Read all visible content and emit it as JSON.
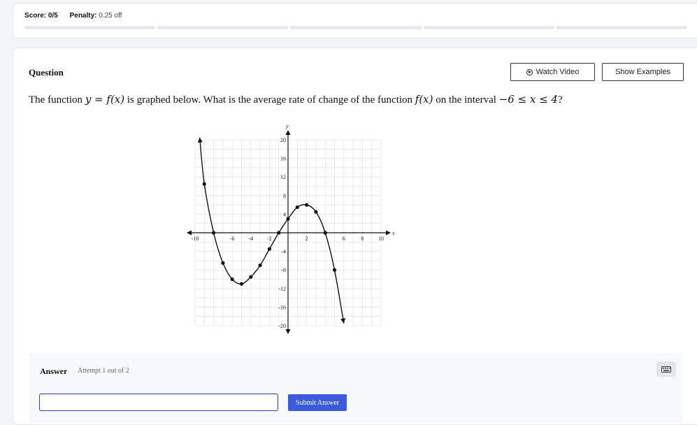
{
  "header": {
    "score_label": "Score:",
    "score_value": "0/5",
    "penalty_label": "Penalty:",
    "penalty_value": "0.25 off",
    "progress_segments": 5
  },
  "question": {
    "label": "Question",
    "watch_video": "Watch Video",
    "show_examples": "Show Examples",
    "text_1": "The function ",
    "math_1": "y = f(x)",
    "text_2": " is graphed below. What is the average rate of change of the function ",
    "math_2": "f(x)",
    "text_3": " on the interval ",
    "math_3": "−6 ≤ x ≤ 4",
    "text_4": "?"
  },
  "graph": {
    "x_axis_label": "x",
    "y_axis_label": "y",
    "x_tick_labels": [
      {
        "value": -10,
        "label": "-10"
      },
      {
        "value": -6,
        "label": "-6"
      },
      {
        "value": -4,
        "label": "-4"
      },
      {
        "value": -2,
        "label": "-2"
      },
      {
        "value": 2,
        "label": "2"
      },
      {
        "value": 6,
        "label": "6"
      },
      {
        "value": 8,
        "label": "8"
      },
      {
        "value": 10,
        "label": "10"
      }
    ],
    "y_tick_labels": [
      {
        "value": 20,
        "label": "20"
      },
      {
        "value": 16,
        "label": "16"
      },
      {
        "value": 12,
        "label": "12"
      },
      {
        "value": 8,
        "label": "8"
      },
      {
        "value": 4,
        "label": "4"
      },
      {
        "value": -4,
        "label": "-4"
      },
      {
        "value": -8,
        "label": "-8"
      },
      {
        "value": -12,
        "label": "-12"
      },
      {
        "value": -16,
        "label": "-16"
      },
      {
        "value": -20,
        "label": "-20"
      }
    ],
    "x_range": [
      -10,
      10
    ],
    "y_range": [
      -20,
      20
    ],
    "grid": true,
    "points": [
      {
        "x": -9,
        "y": 10.5
      },
      {
        "x": -8,
        "y": 0
      },
      {
        "x": -7,
        "y": -6.5
      },
      {
        "x": -6,
        "y": -10
      },
      {
        "x": -5,
        "y": -11
      },
      {
        "x": -4,
        "y": -9.5
      },
      {
        "x": -3,
        "y": -7
      },
      {
        "x": -2,
        "y": -3.5
      },
      {
        "x": -1,
        "y": 0
      },
      {
        "x": 0,
        "y": 3
      },
      {
        "x": 1,
        "y": 5.5
      },
      {
        "x": 2,
        "y": 6
      },
      {
        "x": 3,
        "y": 4.5
      },
      {
        "x": 4,
        "y": 0
      },
      {
        "x": 5,
        "y": -8
      }
    ],
    "curve_start": {
      "x": -9.5,
      "y": 20.5
    },
    "curve_end": {
      "x": 6,
      "y": -19.5
    }
  },
  "answer": {
    "label": "Answer",
    "attempt": "Attempt 1 out of 2",
    "input_value": "",
    "submit": "Submit Answer"
  }
}
